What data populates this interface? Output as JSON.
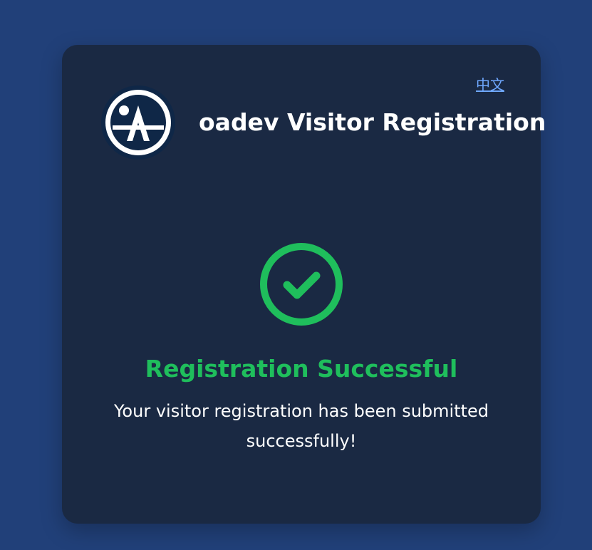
{
  "header": {
    "language_link": "中文",
    "title": "oadev Visitor Registration"
  },
  "icons": {
    "logo": "oadev-logo",
    "status": "check-circle-icon"
  },
  "result": {
    "title": "Registration Successful",
    "message": "Your visitor registration has been submitted successfully!"
  },
  "colors": {
    "background": "#214079",
    "card": "#1a2943",
    "success": "#1fbe5c",
    "link": "#6fa8ff"
  }
}
